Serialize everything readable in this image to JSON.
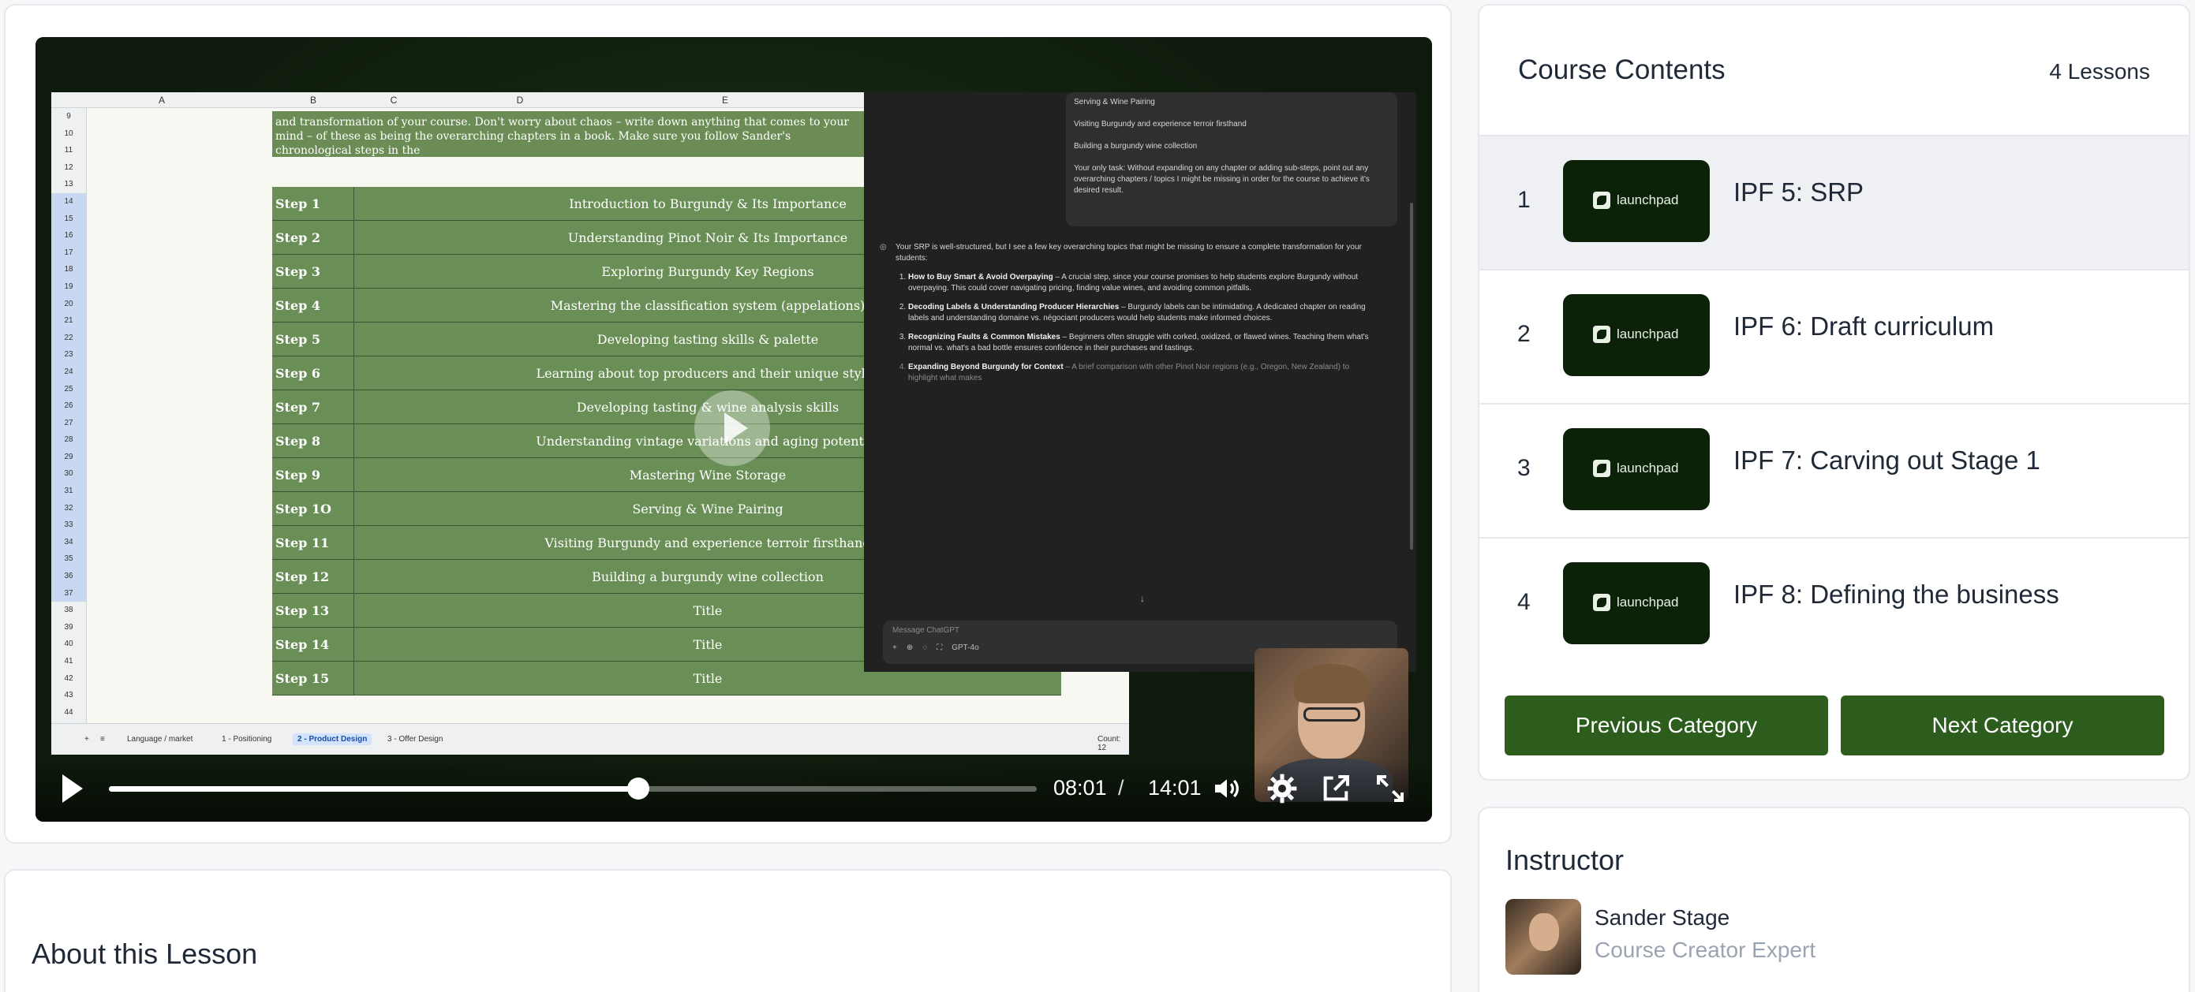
{
  "video": {
    "spreadsheet": {
      "columns": [
        "A",
        "B",
        "C",
        "D",
        "E"
      ],
      "row_numbers": [
        "9",
        "10",
        "11",
        "12",
        "13",
        "14",
        "15",
        "16",
        "17",
        "18",
        "19",
        "20",
        "21",
        "22",
        "23",
        "24",
        "25",
        "26",
        "27",
        "28",
        "29",
        "30",
        "31",
        "32",
        "33",
        "34",
        "35",
        "36",
        "37",
        "38",
        "39",
        "40",
        "41",
        "42",
        "43",
        "44"
      ],
      "intro_text": "and transformation of your course. Don't worry about chaos – write down anything that comes to your mind – of these as being the overarching chapters in a book. Make sure you follow Sander's chronological steps in the",
      "steps": [
        {
          "num": "Step 1",
          "title": "Introduction to Burgundy & Its Importance"
        },
        {
          "num": "Step 2",
          "title": "Understanding Pinot Noir & Its Importance"
        },
        {
          "num": "Step 3",
          "title": "Exploring Burgundy Key Regions"
        },
        {
          "num": "Step 4",
          "title": "Mastering the classification system (appelations)"
        },
        {
          "num": "Step 5",
          "title": "Developing tasting skills & palette"
        },
        {
          "num": "Step 6",
          "title": "Learning about top producers and their unique styles"
        },
        {
          "num": "Step 7",
          "title": "Developing tasting & wine analysis skills"
        },
        {
          "num": "Step 8",
          "title": "Understanding vintage variations and aging potential"
        },
        {
          "num": "Step 9",
          "title": "Mastering Wine Storage"
        },
        {
          "num": "Step 1O",
          "title": "Serving & Wine Pairing"
        },
        {
          "num": "Step 11",
          "title": "Visiting Burgundy and experience terroir firsthand"
        },
        {
          "num": "Step 12",
          "title": "Building a burgundy wine collection"
        },
        {
          "num": "Step 13",
          "title": "Title"
        },
        {
          "num": "Step 14",
          "title": "Title"
        },
        {
          "num": "Step 15",
          "title": "Title"
        }
      ],
      "tabs": [
        "Language / market",
        "1 - Positioning",
        "2 - Product Design",
        "3 - Offer Design"
      ],
      "active_tab": "2 - Product Design",
      "count_label": "Count: 12"
    },
    "chat": {
      "user_lines": [
        "Serving & Wine Pairing",
        "Visiting Burgundy and experience terroir firsthand",
        "Building a burgundy wine collection",
        "Your only task: Without expanding on any chapter or adding sub-steps, point out any overarching chapters / topics I might be missing in order for the course to achieve it's desired result."
      ],
      "reply_lead": "Your SRP is well-structured, but I see a few key overarching topics that might be missing to ensure a complete transformation for your students:",
      "reply_items": [
        {
          "title": "How to Buy Smart & Avoid Overpaying",
          "text": " – A crucial step, since your course promises to help students explore Burgundy without overpaying. This could cover navigating pricing, finding value wines, and avoiding common pitfalls."
        },
        {
          "title": "Decoding Labels & Understanding Producer Hierarchies",
          "text": " – Burgundy labels can be intimidating. A dedicated chapter on reading labels and understanding domaine vs. négociant producers would help students make informed choices."
        },
        {
          "title": "Recognizing Faults & Common Mistakes",
          "text": " – Beginners often struggle with corked, oxidized, or flawed wines. Teaching them what's normal vs. what's a bad bottle ensures confidence in their purchases and tastings."
        },
        {
          "title": "Expanding Beyond Burgundy for Context",
          "text": " – A brief comparison with other Pinot Noir regions (e.g., Oregon, New Zealand) to highlight what makes"
        }
      ],
      "composer_placeholder": "Message ChatGPT",
      "model_label": "GPT-4o"
    },
    "current_time": "08:01",
    "time_separator": "/",
    "duration": "14:01",
    "progress_fraction": 0.571,
    "buffered_fraction": 0.2
  },
  "about": {
    "title": "About this Lesson"
  },
  "course": {
    "title": "Course Contents",
    "lesson_count": "4 Lessons",
    "lessons": [
      {
        "index": "1",
        "name": "IPF 5: SRP",
        "thumb_label": "launchpad",
        "active": true
      },
      {
        "index": "2",
        "name": "IPF 6: Draft curriculum",
        "thumb_label": "launchpad",
        "active": false
      },
      {
        "index": "3",
        "name": "IPF 7: Carving out Stage 1",
        "thumb_label": "launchpad",
        "active": false
      },
      {
        "index": "4",
        "name": "IPF 8: Defining the business",
        "thumb_label": "launchpad",
        "active": false
      }
    ],
    "prev_label": "Previous Category",
    "next_label": "Next Category"
  },
  "instructor": {
    "title": "Instructor",
    "name": "Sander Stage",
    "role": "Course Creator Expert"
  },
  "colors": {
    "accent": "#2d5d1d",
    "thumb_bg": "#0b2108",
    "step_green": "#6a8f56"
  },
  "icons": [
    "play-icon",
    "volume-icon",
    "settings-icon",
    "popout-icon",
    "fullscreen-icon"
  ]
}
